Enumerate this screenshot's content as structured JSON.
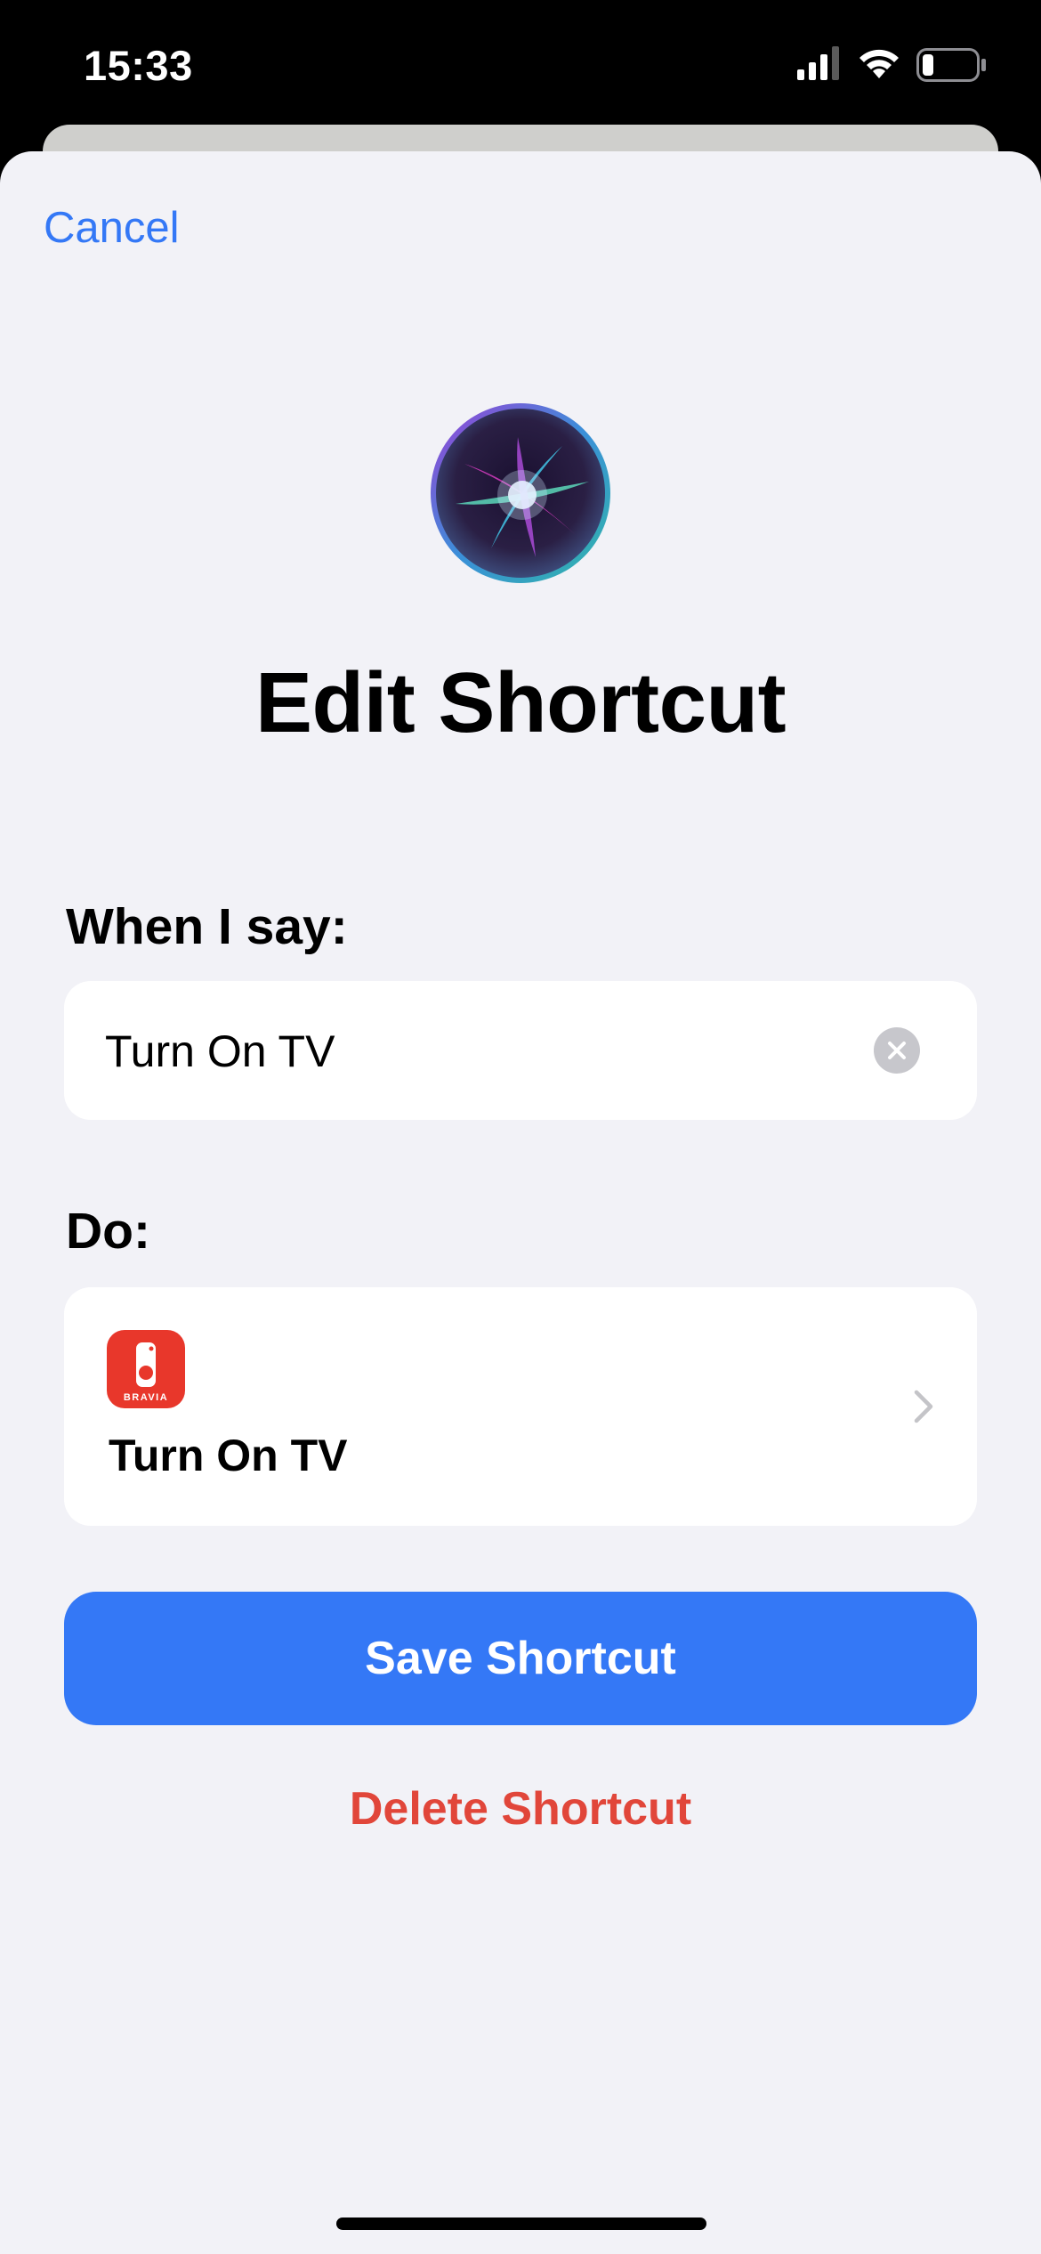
{
  "status_bar": {
    "time": "15:33",
    "icons": [
      "cellular-signal-icon",
      "wifi-icon",
      "battery-icon"
    ],
    "battery_level": 0.2
  },
  "sheet": {
    "cancel_label": "Cancel",
    "siri_icon": "siri-orb-icon",
    "title": "Edit Shortcut"
  },
  "phrase_section": {
    "label": "When I say:",
    "value": "Turn On TV",
    "clear_icon": "clear-icon"
  },
  "action_section": {
    "label": "Do:",
    "app_icon": "bravia-app-icon",
    "app_icon_text": "BRAVIA",
    "action_title": "Turn On TV",
    "chevron_icon": "chevron-right-icon"
  },
  "buttons": {
    "save_label": "Save Shortcut",
    "delete_label": "Delete Shortcut"
  },
  "colors": {
    "accent": "#3478f6",
    "destructive": "#e1463a",
    "sheet_background": "#f2f2f7",
    "app_icon_red": "#e8372b"
  }
}
